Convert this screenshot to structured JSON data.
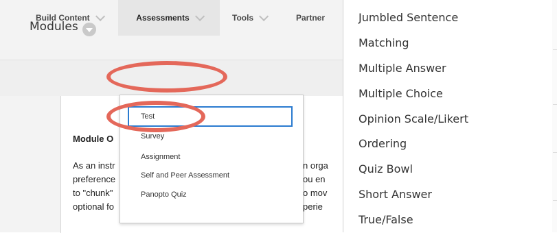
{
  "modules": {
    "title": "Modules"
  },
  "nav": {
    "build_content": "Build Content",
    "assessments": "Assessments",
    "tools": "Tools",
    "partner": "Partner"
  },
  "content": {
    "heading": "Module O",
    "lines": [
      "As an instr",
      "preference",
      "to \"chunk\"",
      "optional fo"
    ],
    "right_fragments": [
      "n orga",
      "ou en",
      "o mov",
      "perie"
    ]
  },
  "dropdown": {
    "items": [
      "Test",
      "Survey",
      "Assignment",
      "Self and Peer Assessment",
      "Panopto Quiz"
    ]
  },
  "question_types": [
    "Jumbled Sentence",
    "Matching",
    "Multiple Answer",
    "Multiple Choice",
    "Opinion Scale/Likert",
    "Ordering",
    "Quiz Bowl",
    "Short Answer",
    "True/False"
  ],
  "colors": {
    "highlight": "#e4685a",
    "focus": "#2a7bd0"
  }
}
